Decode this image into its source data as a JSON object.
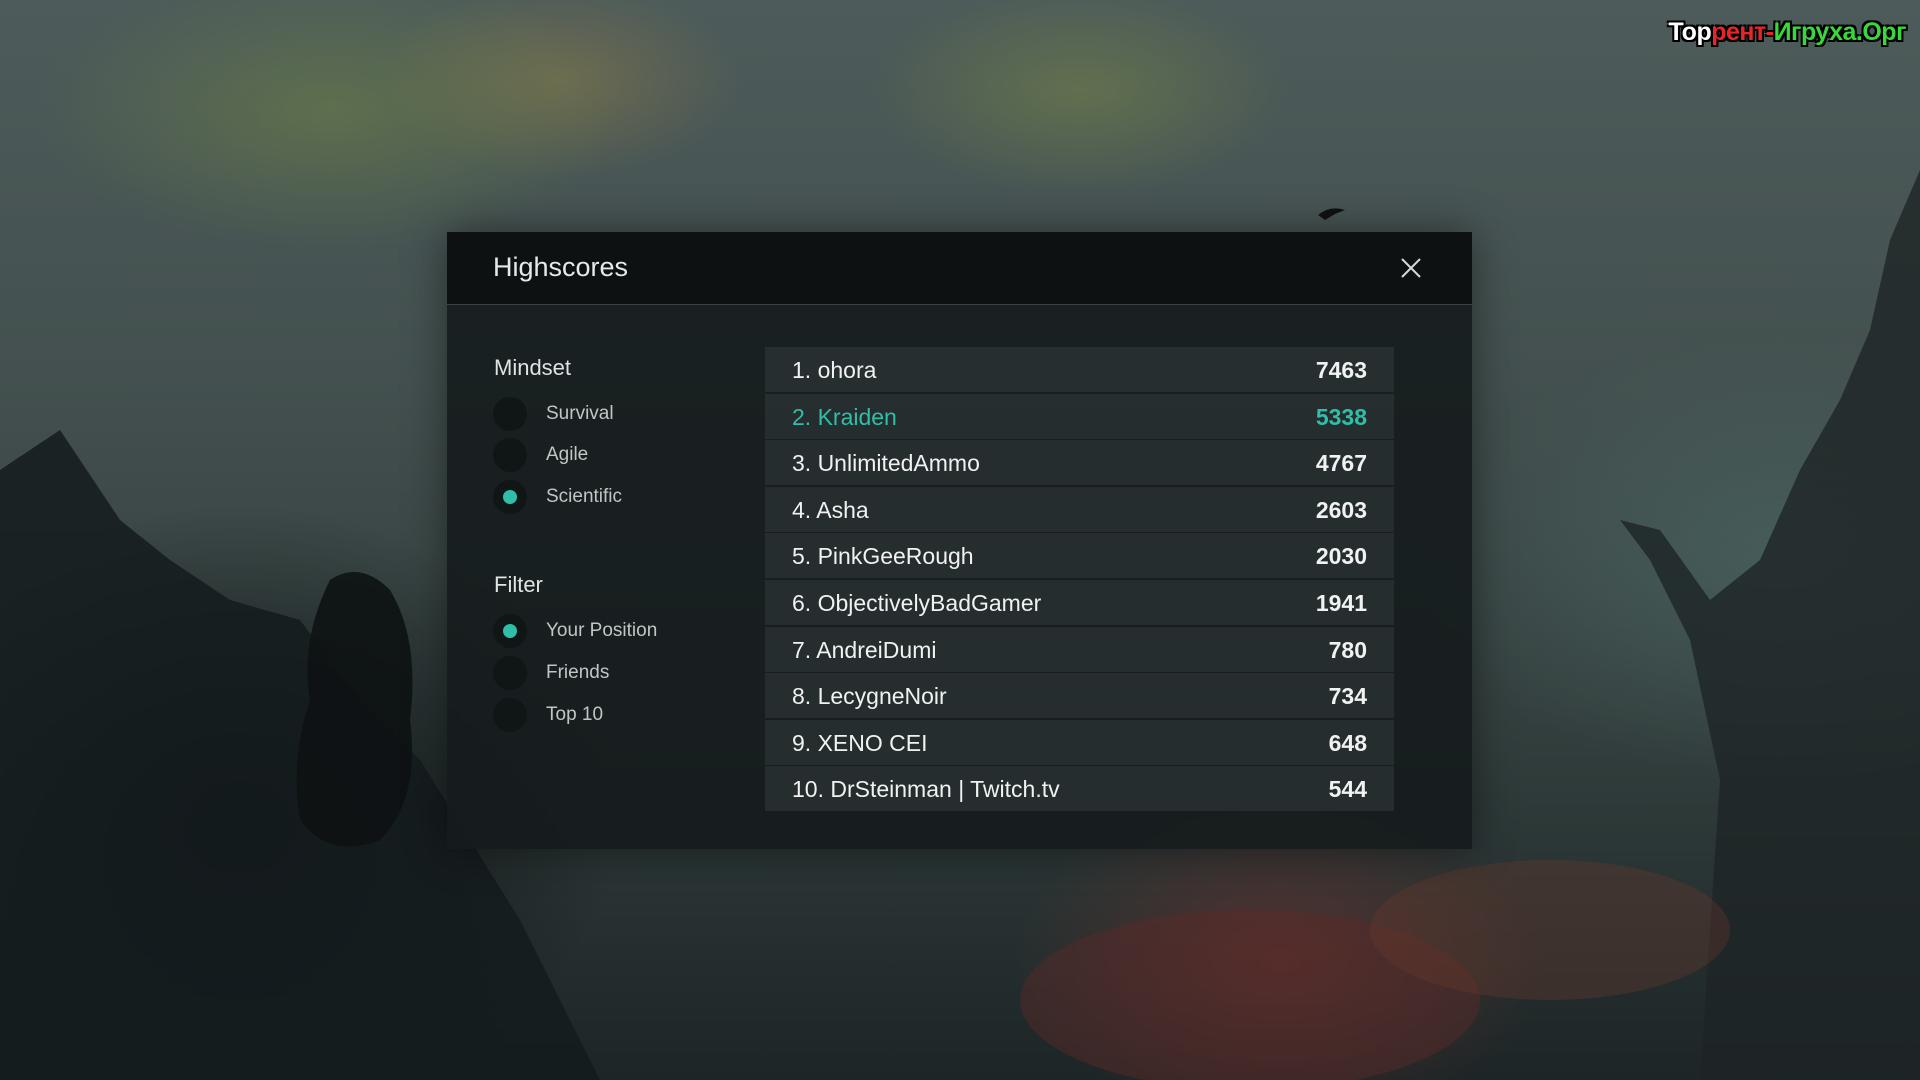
{
  "watermark": {
    "part1": "Тор",
    "part2": "рент-",
    "part3": "Игруха.Орг"
  },
  "dialog": {
    "title": "Highscores",
    "close_icon": "close-icon"
  },
  "mindset": {
    "title": "Mindset",
    "options": [
      {
        "label": "Survival",
        "selected": false
      },
      {
        "label": "Agile",
        "selected": false
      },
      {
        "label": "Scientific",
        "selected": true
      }
    ]
  },
  "filter": {
    "title": "Filter",
    "options": [
      {
        "label": "Your Position",
        "selected": true
      },
      {
        "label": "Friends",
        "selected": false
      },
      {
        "label": "Top 10",
        "selected": false
      }
    ]
  },
  "highscores": [
    {
      "name": "1. ohora",
      "score": "7463",
      "highlighted": false
    },
    {
      "name": "2. Kraiden",
      "score": "5338",
      "highlighted": true
    },
    {
      "name": "3. UnlimitedAmmo",
      "score": "4767",
      "highlighted": false
    },
    {
      "name": "4. Asha",
      "score": "2603",
      "highlighted": false
    },
    {
      "name": "5. PinkGeeRough",
      "score": "2030",
      "highlighted": false
    },
    {
      "name": "6. ObjectivelyBadGamer",
      "score": "1941",
      "highlighted": false
    },
    {
      "name": "7. AndreiDumi",
      "score": "780",
      "highlighted": false
    },
    {
      "name": "8. LecygneNoir",
      "score": "734",
      "highlighted": false
    },
    {
      "name": "9. XENO CEI",
      "score": "648",
      "highlighted": false
    },
    {
      "name": "10. DrSteinman | Twitch.tv",
      "score": "544",
      "highlighted": false
    }
  ],
  "colors": {
    "accent": "#2fbfa8",
    "dialog_bg": "#151b1c",
    "row_bg": "#283031",
    "text": "#f0f2f1"
  }
}
